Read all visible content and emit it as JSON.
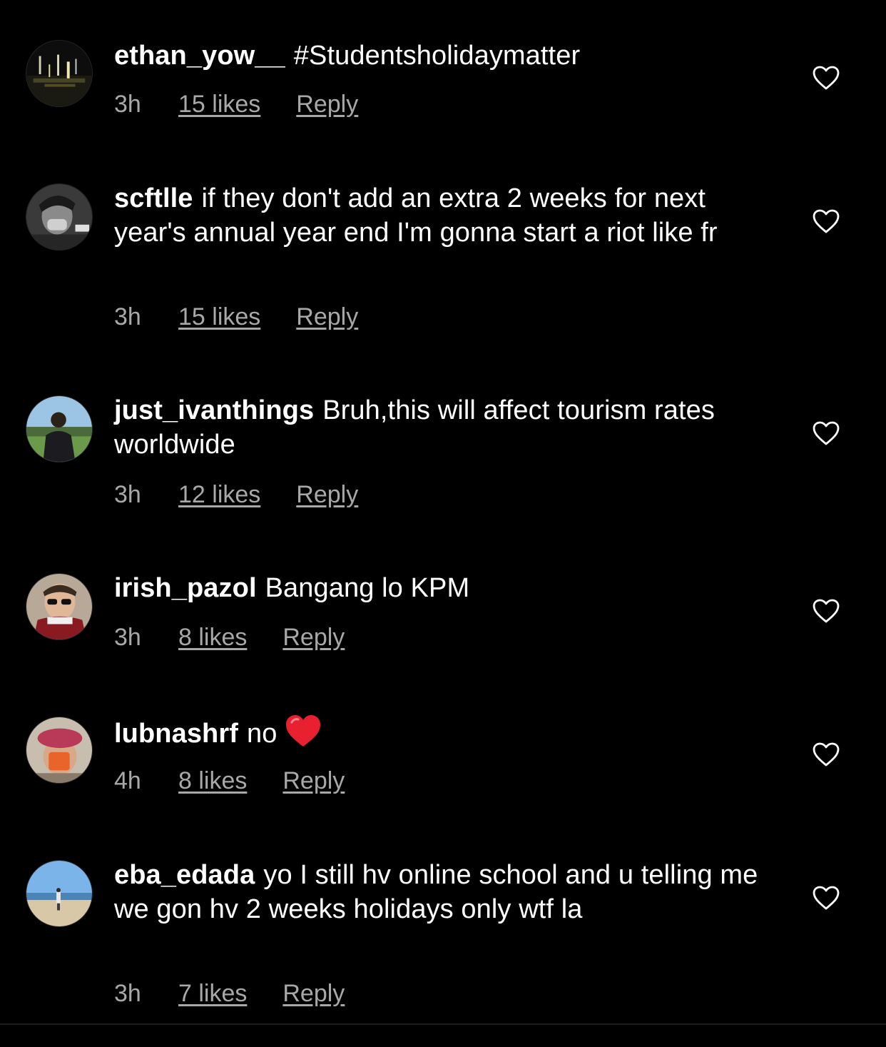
{
  "colors": {
    "background": "#000000",
    "text_primary": "#ffffff",
    "text_secondary": "#a8a8a8",
    "emoji_heart": "#e8202f"
  },
  "comments": [
    {
      "username": "ethan_yow__",
      "text": "#Studentsholidaymatter",
      "time": "3h",
      "likes": "15 likes",
      "reply": "Reply",
      "avatar_icon": "night-city-lights-avatar",
      "like_icon": "heart-outline-icon"
    },
    {
      "username": "scftlle",
      "text": "if they don't add an extra 2 weeks for next year's annual year end I'm gonna start a riot like fr",
      "time": "3h",
      "likes": "15 likes",
      "reply": "Reply",
      "avatar_icon": "grayscale-selfie-avatar",
      "like_icon": "heart-outline-icon"
    },
    {
      "username": "just_ivanthings",
      "text": "Bruh,this will affect tourism rates worldwide",
      "time": "3h",
      "likes": "12 likes",
      "reply": "Reply",
      "avatar_icon": "person-outdoors-avatar",
      "like_icon": "heart-outline-icon"
    },
    {
      "username": "irish_pazol",
      "text": "Bangang lo KPM",
      "time": "3h",
      "likes": "8 likes",
      "reply": "Reply",
      "avatar_icon": "person-sunglasses-avatar",
      "like_icon": "heart-outline-icon"
    },
    {
      "username": "lubnashrf",
      "text": "no",
      "emoji": "red-heart-emoji",
      "time": "4h",
      "likes": "8 likes",
      "reply": "Reply",
      "avatar_icon": "person-beret-avatar",
      "like_icon": "heart-outline-icon"
    },
    {
      "username": "eba_edada",
      "text": "yo I still hv online school and u telling me we gon hv 2 weeks holidays only wtf la",
      "time": "3h",
      "likes": "7 likes",
      "reply": "Reply",
      "avatar_icon": "beach-person-avatar",
      "like_icon": "heart-outline-icon"
    }
  ]
}
